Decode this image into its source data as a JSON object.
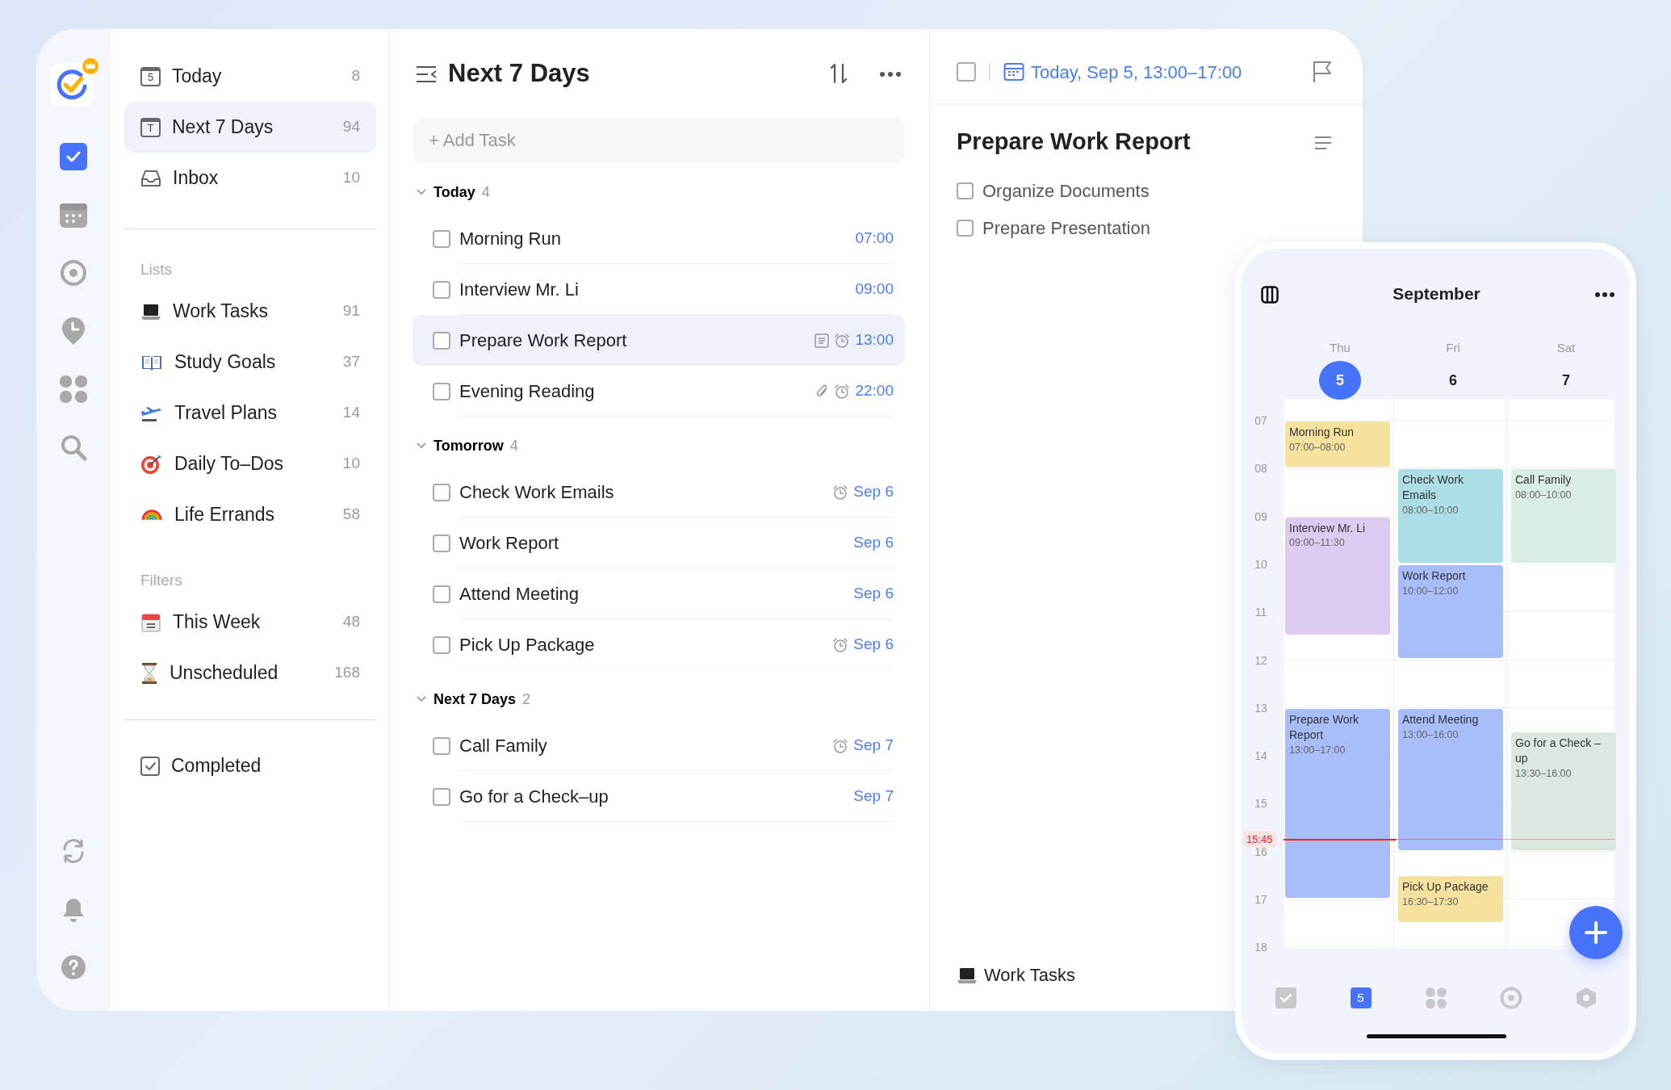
{
  "rail": {
    "items": [
      {
        "selected": true
      },
      {
        "selected": false
      },
      {
        "selected": false
      },
      {
        "selected": false
      },
      {
        "selected": false
      },
      {
        "selected": false
      }
    ]
  },
  "sidebar": {
    "smart_lists": [
      {
        "label": "Today",
        "count": "8",
        "icon_text": "5",
        "selected": false
      },
      {
        "label": "Next 7 Days",
        "count": "94",
        "icon_text": "T",
        "selected": true
      },
      {
        "label": "Inbox",
        "count": "10",
        "selected": false
      }
    ],
    "lists_heading": "Lists",
    "lists": [
      {
        "label": "Work Tasks",
        "count": "91",
        "selected": false
      },
      {
        "label": "Study Goals",
        "count": "37",
        "selected": false
      },
      {
        "label": "Travel Plans",
        "count": "14",
        "selected": false
      },
      {
        "label": "Daily To–Dos",
        "count": "10",
        "selected": false
      },
      {
        "label": "Life Errands",
        "count": "58",
        "selected": false
      }
    ],
    "filters_heading": "Filters",
    "filters": [
      {
        "label": "This Week",
        "count": "48",
        "selected": false
      },
      {
        "label": "Unscheduled",
        "count": "168",
        "selected": false
      }
    ],
    "completed": {
      "label": "Completed",
      "selected": false
    }
  },
  "task_list": {
    "title": "Next 7 Days",
    "add_task": {
      "placeholder": "+ Add Task"
    },
    "groups": [
      {
        "title": "Today",
        "count": "4",
        "expanded": true,
        "tasks": [
          {
            "title": "Morning Run",
            "due": "07:00",
            "checked": false,
            "selected": false
          },
          {
            "title": "Interview Mr. Li",
            "due": "09:00",
            "checked": false,
            "selected": false
          },
          {
            "title": "Prepare Work Report",
            "due": "13:00",
            "checked": false,
            "selected": true,
            "indicators": [
              {
                "kind": "note"
              },
              {
                "kind": "alarm"
              }
            ]
          },
          {
            "title": "Evening Reading",
            "due": "22:00",
            "checked": false,
            "selected": false,
            "indicators": [
              {
                "kind": "attachment"
              },
              {
                "kind": "alarm"
              }
            ]
          }
        ]
      },
      {
        "title": "Tomorrow",
        "count": "4",
        "expanded": true,
        "tasks": [
          {
            "title": "Check Work Emails",
            "due": "Sep 6",
            "checked": false,
            "selected": false,
            "indicators": [
              {
                "kind": "alarm"
              }
            ]
          },
          {
            "title": "Work Report",
            "due": "Sep 6",
            "checked": false,
            "selected": false
          },
          {
            "title": "Attend Meeting",
            "due": "Sep 6",
            "checked": false,
            "selected": false
          },
          {
            "title": "Pick Up Package",
            "due": "Sep 6",
            "checked": false,
            "selected": false,
            "indicators": [
              {
                "kind": "alarm"
              }
            ]
          }
        ]
      },
      {
        "title": "Next 7 Days",
        "count": "2",
        "expanded": true,
        "tasks": [
          {
            "title": "Call Family",
            "due": "Sep 7",
            "checked": false,
            "selected": false,
            "indicators": [
              {
                "kind": "alarm"
              }
            ]
          },
          {
            "title": "Go for a Check–up",
            "due": "Sep 7",
            "checked": false,
            "selected": false
          }
        ]
      }
    ]
  },
  "detail": {
    "checked": false,
    "date": "Today, Sep 5, 13:00–17:00",
    "title": "Prepare Work Report",
    "subtasks": [
      {
        "title": "Organize Documents",
        "checked": false
      },
      {
        "title": "Prepare Presentation",
        "checked": false
      }
    ],
    "list": "Work Tasks"
  },
  "phone": {
    "month": "September",
    "days": [
      {
        "name": "Thu",
        "date": "5",
        "selected": true,
        "events": [
          {
            "title": "Morning Run",
            "time": "07:00–08:00",
            "color": "#f5e29e"
          },
          {
            "title": "Interview Mr. Li",
            "time": "09:00–11:30",
            "color": "#dccbf0"
          },
          {
            "title": "Prepare Work Report",
            "time": "13:00–17:00",
            "color": "#a9bdfa"
          }
        ]
      },
      {
        "name": "Fri",
        "date": "6",
        "selected": false,
        "events": [
          {
            "title": "Check Work Emails",
            "time": "08:00–10:00",
            "color": "#acdfe5"
          },
          {
            "title": "Work Report",
            "time": "10:00–12:00",
            "color": "#a9bdfa"
          },
          {
            "title": "Attend Meeting",
            "time": "13:00–16:00",
            "color": "#a9bdfa"
          },
          {
            "title": "Pick Up Package",
            "time": "16:30–17:30",
            "color": "#f5e29e"
          }
        ]
      },
      {
        "name": "Sat",
        "date": "7",
        "selected": false,
        "events": [
          {
            "title": "Call Family",
            "time": "08:00–10:00",
            "color": "#dbece3"
          },
          {
            "title": "Go for a Check –up",
            "time": "13:30–16:00",
            "color": "#dbe8e0"
          }
        ]
      }
    ],
    "hours": [
      "07",
      "08",
      "09",
      "10",
      "11",
      "12",
      "13",
      "14",
      "15",
      "16",
      "17",
      "18"
    ],
    "now": "15:45",
    "tabs": [
      {
        "selected": false
      },
      {
        "selected": true,
        "icon_text": "5"
      },
      {
        "selected": false
      },
      {
        "selected": false
      },
      {
        "selected": false
      }
    ]
  }
}
